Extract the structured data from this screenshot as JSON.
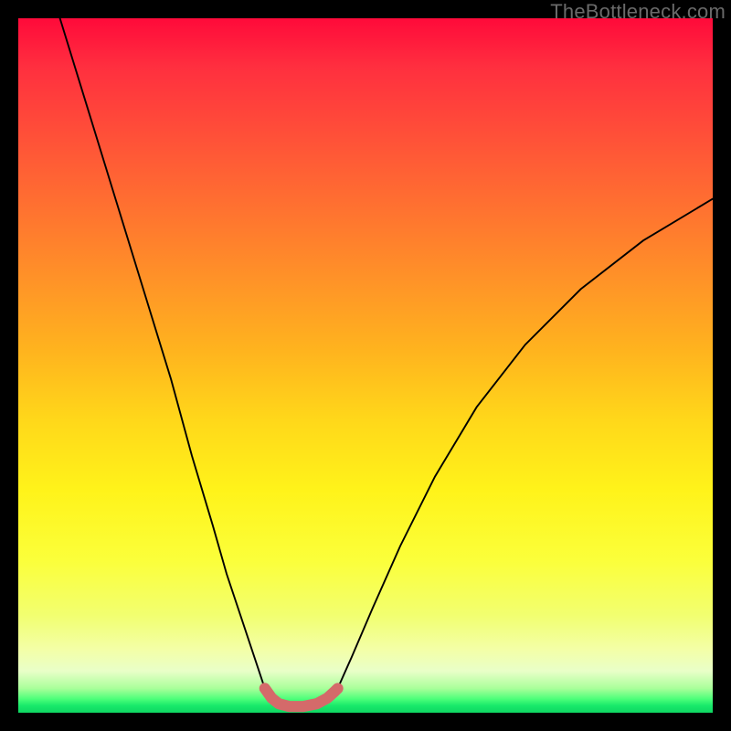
{
  "watermark": "TheBottleneck.com",
  "chart_data": {
    "type": "line",
    "title": "",
    "xlabel": "",
    "ylabel": "",
    "xlim": [
      0,
      100
    ],
    "ylim": [
      0,
      100
    ],
    "grid": false,
    "legend": false,
    "series": [
      {
        "name": "left-curve-black",
        "color": "#000000",
        "x": [
          6,
          10,
          14,
          18,
          22,
          25,
          28,
          30,
          32,
          34,
          35.5
        ],
        "y": [
          100,
          87,
          74,
          61,
          48,
          37,
          27,
          20,
          14,
          8,
          3.5
        ]
      },
      {
        "name": "right-curve-black",
        "color": "#000000",
        "x": [
          46,
          48,
          51,
          55,
          60,
          66,
          73,
          81,
          90,
          100
        ],
        "y": [
          3.5,
          8,
          15,
          24,
          34,
          44,
          53,
          61,
          68,
          74
        ]
      },
      {
        "name": "valley-highlight-pink",
        "color": "#d46a6a",
        "x": [
          35.5,
          36.5,
          37.5,
          39,
          41,
          43,
          44.5,
          45.5,
          46
        ],
        "y": [
          3.5,
          2.1,
          1.3,
          0.9,
          0.9,
          1.3,
          2.1,
          3.0,
          3.5
        ]
      }
    ],
    "background_gradient": {
      "direction": "top-to-bottom",
      "stops": [
        {
          "pos": 0,
          "color": "#ff0a3a"
        },
        {
          "pos": 20,
          "color": "#ff5a36"
        },
        {
          "pos": 48,
          "color": "#ffb41e"
        },
        {
          "pos": 68,
          "color": "#fff31a"
        },
        {
          "pos": 91,
          "color": "#f3ffa8"
        },
        {
          "pos": 98,
          "color": "#4dff7a"
        },
        {
          "pos": 100,
          "color": "#0fd763"
        }
      ]
    }
  }
}
